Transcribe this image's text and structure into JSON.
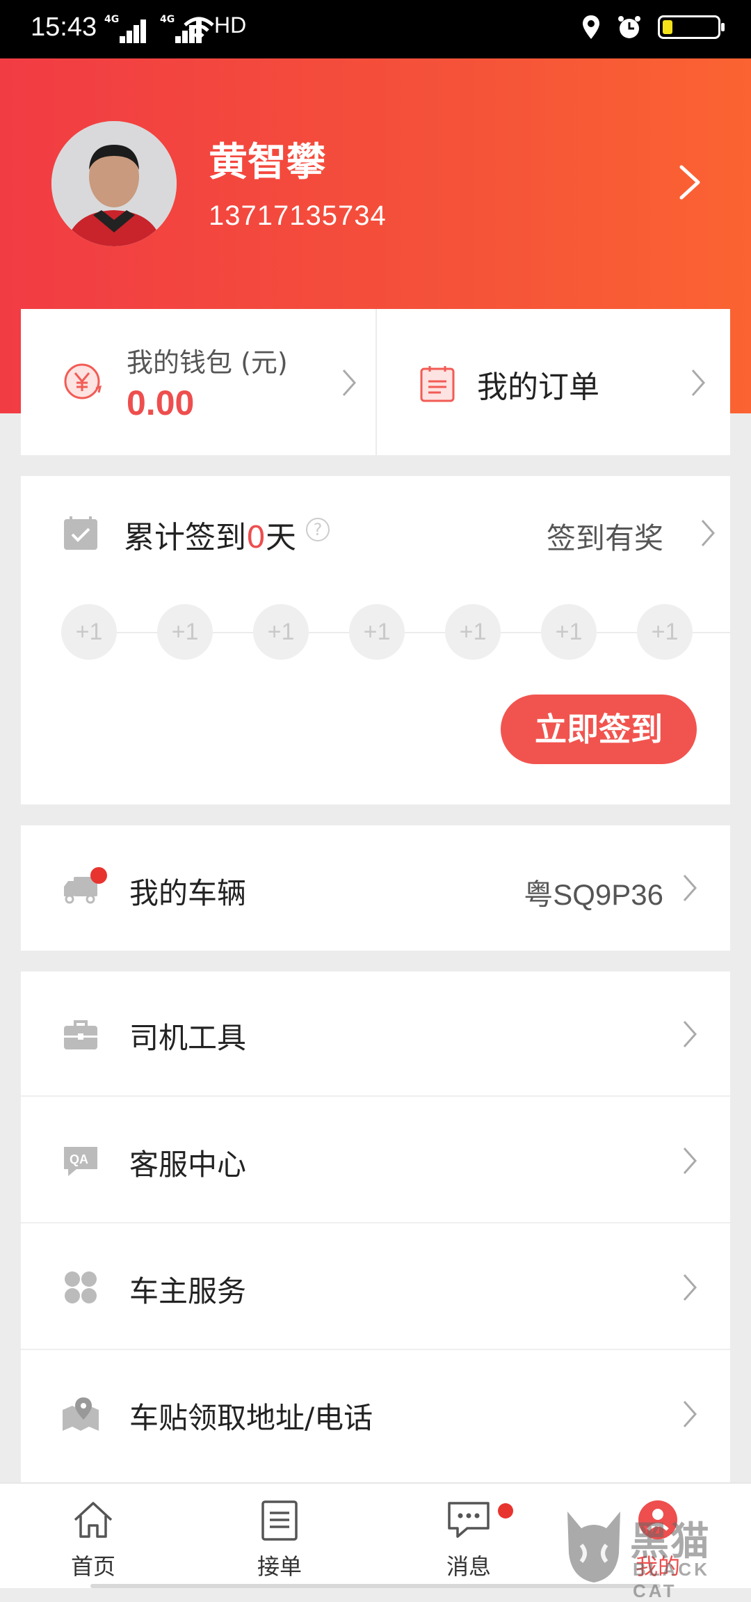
{
  "status_bar": {
    "time": "15:43",
    "signal1": "4G",
    "signal2": "4G",
    "hd": "HD",
    "battery_level": 0.15
  },
  "profile": {
    "name": "黄智攀",
    "phone": "13717135734"
  },
  "wallet": {
    "label": "我的钱包 (元)",
    "value": "0.00"
  },
  "orders": {
    "label": "我的订单"
  },
  "checkin": {
    "prefix": "累计签到",
    "days": "0",
    "suffix": "天",
    "help": "?",
    "reward_label": "签到有奖",
    "dots": [
      "+1",
      "+1",
      "+1",
      "+1",
      "+1",
      "+1",
      "+1"
    ],
    "button_label": "立即签到"
  },
  "vehicle": {
    "label": "我的车辆",
    "plate": "粤SQ9P36"
  },
  "menu": [
    {
      "label": "司机工具",
      "icon": "toolbox-icon"
    },
    {
      "label": "客服中心",
      "icon": "qa-icon"
    },
    {
      "label": "车主服务",
      "icon": "services-grid-icon"
    },
    {
      "label": "车贴领取地址/电话",
      "icon": "map-pin-icon"
    }
  ],
  "bottom_nav": [
    {
      "label": "首页",
      "icon": "home-icon"
    },
    {
      "label": "接单",
      "icon": "order-list-icon"
    },
    {
      "label": "消息",
      "icon": "message-icon"
    },
    {
      "label": "我的",
      "icon": "profile-icon",
      "active": true
    }
  ],
  "watermark": {
    "text": "黑猫",
    "subtext": "BLACK CAT"
  },
  "colors": {
    "accent": "#ee4e4e",
    "header_start": "#f23c44",
    "header_end": "#fb6332"
  }
}
